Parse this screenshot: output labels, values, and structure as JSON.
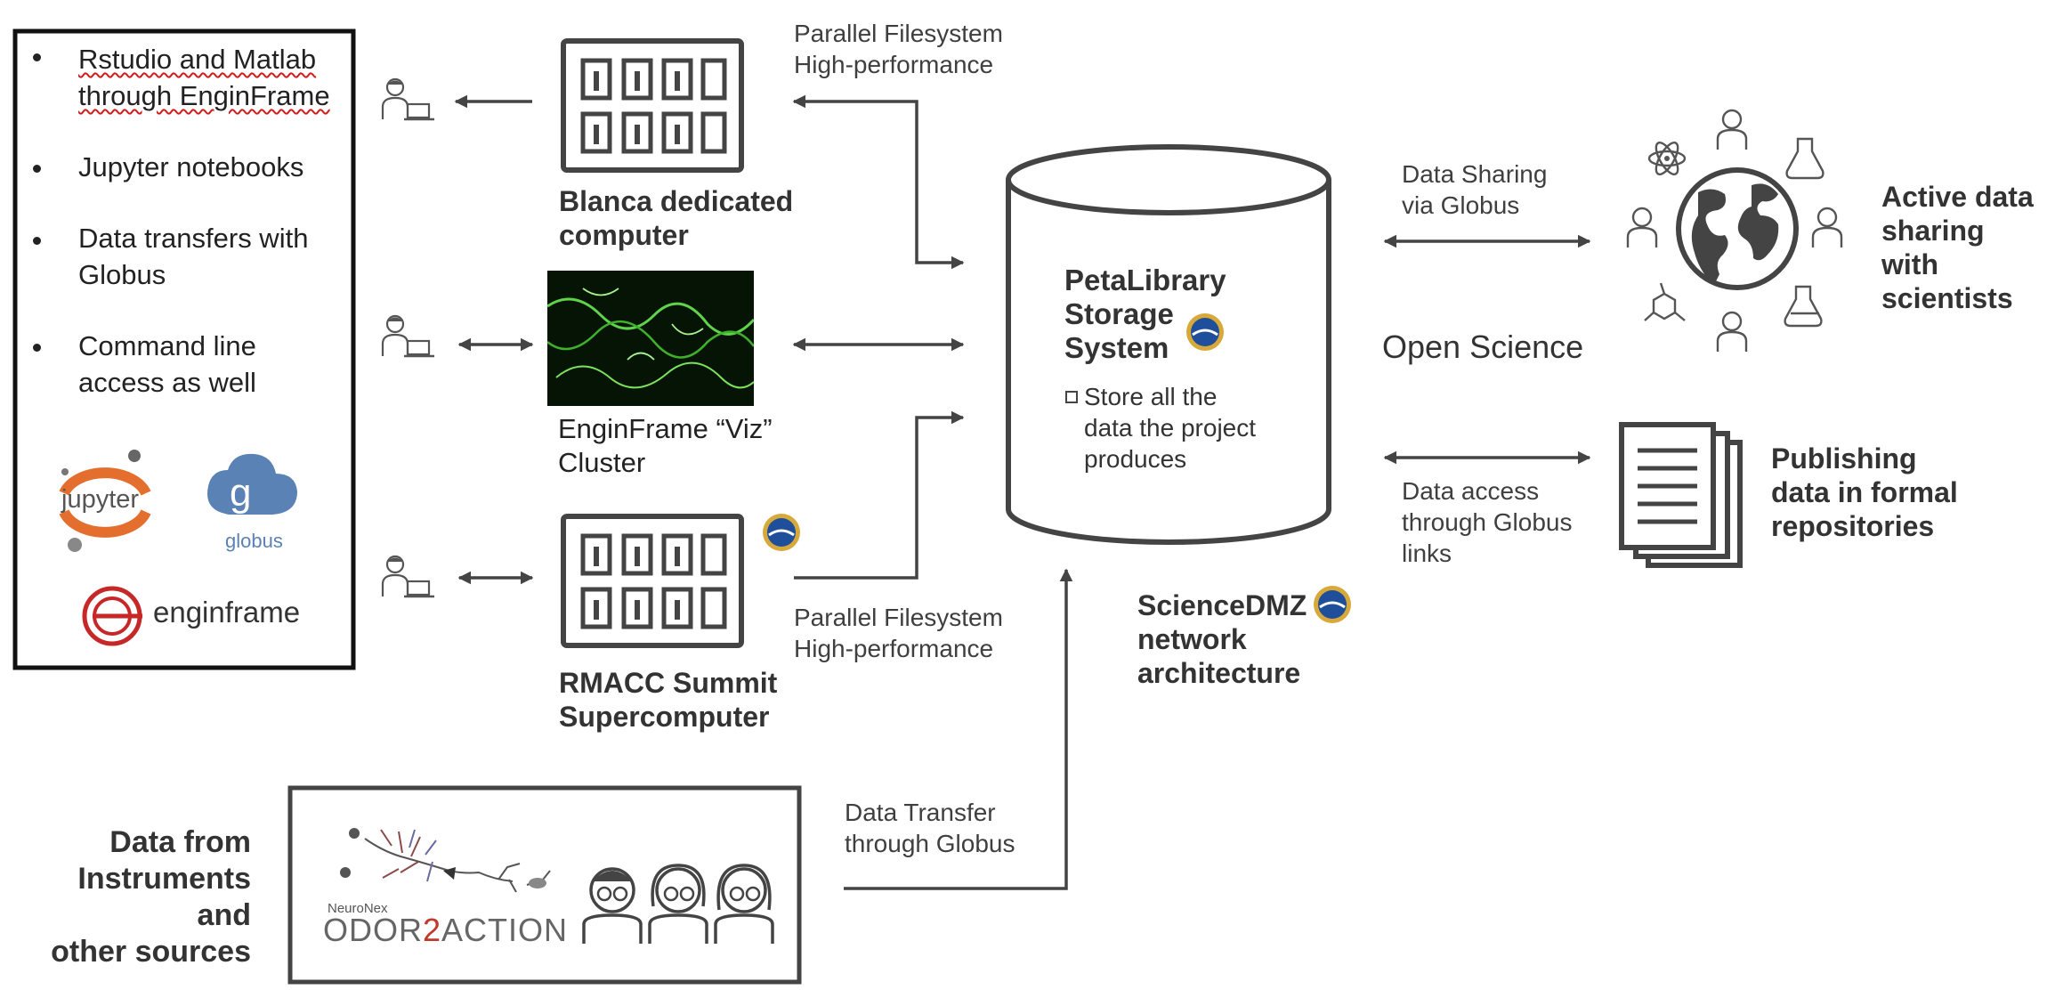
{
  "tools_panel": {
    "items": [
      {
        "text": "Rstudio and Matlab\nthrough EnginFrame"
      },
      {
        "text": "Jupyter notebooks"
      },
      {
        "text": "Data transfers with\nGlobus"
      },
      {
        "text": "Command line\naccess as well"
      }
    ],
    "logos": {
      "jupyter": "jupyter",
      "globus": "globus",
      "enginframe": "enginframe"
    }
  },
  "nodes": {
    "blanca": "Blanca dedicated\ncomputer",
    "viz": "EnginFrame “Viz”\nCluster",
    "summit": "RMACC Summit\nSupercomputer",
    "storage_title": "PetaLibrary\nStorage\nSystem",
    "storage_note": "Store all the\ndata the project\nproduces",
    "science_dmz": "ScienceDMZ\nnetwork\narchitecture",
    "instruments": "Data from\nInstruments and\nother sources"
  },
  "edge_labels": {
    "parallel_top": "Parallel Filesystem\nHigh-performance",
    "parallel_bottom": "Parallel Filesystem\nHigh-performance",
    "data_sharing": "Data Sharing\nvia Globus",
    "data_access": "Data access\nthrough Globus\nlinks",
    "data_transfer": "Data Transfer\nthrough Globus"
  },
  "right_side": {
    "open_science": "Open Science",
    "active_sharing": "Active data\nsharing with\nscientists",
    "publishing": "Publishing\ndata in formal\nrepositories"
  },
  "odor": {
    "small": "NeuroNex",
    "prefix": "ODOR",
    "digit": "2",
    "suffix": "ACTION"
  },
  "colors": {
    "line": "#444444",
    "accent_red": "#c62828",
    "jupyter_orange": "#e46e2e",
    "globus_blue": "#5b82b4"
  }
}
